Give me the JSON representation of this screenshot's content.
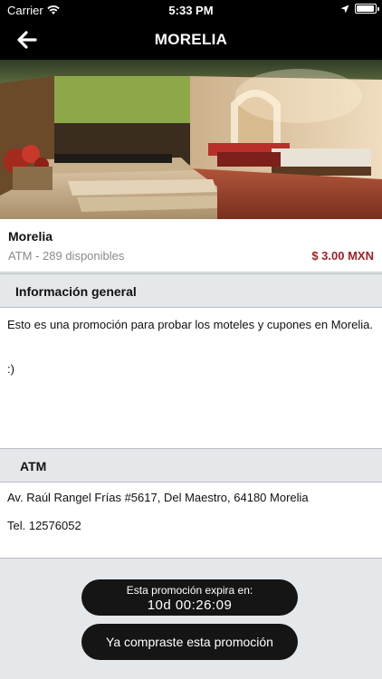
{
  "status_bar": {
    "carrier": "Carrier",
    "time": "5:33 PM",
    "battery_level": 0.95
  },
  "nav": {
    "title": "MORELIA",
    "back_icon": "arrow-left-icon"
  },
  "promotion": {
    "name": "Morelia",
    "availability": "ATM - 289 disponibles",
    "price": "$ 3.00 MXN"
  },
  "general_info": {
    "header": "Información general",
    "text": "Esto es una promoción para probar los moteles y cupones en Morelia.",
    "extra": ":)"
  },
  "location": {
    "header": "ATM",
    "address": "Av. Raúl Rangel Frías #5617, Del Maestro, 64180 Morelia",
    "phone": "Tel. 12576052"
  },
  "expiry": {
    "label": "Esta promoción expira en:",
    "countdown": "10d 00:26:09"
  },
  "purchase": {
    "label": "Ya compraste esta promoción"
  },
  "colors": {
    "price": "#a31f24",
    "nav_background": "#000000",
    "pill_background": "#151515",
    "section_background": "#e5e8ea"
  }
}
